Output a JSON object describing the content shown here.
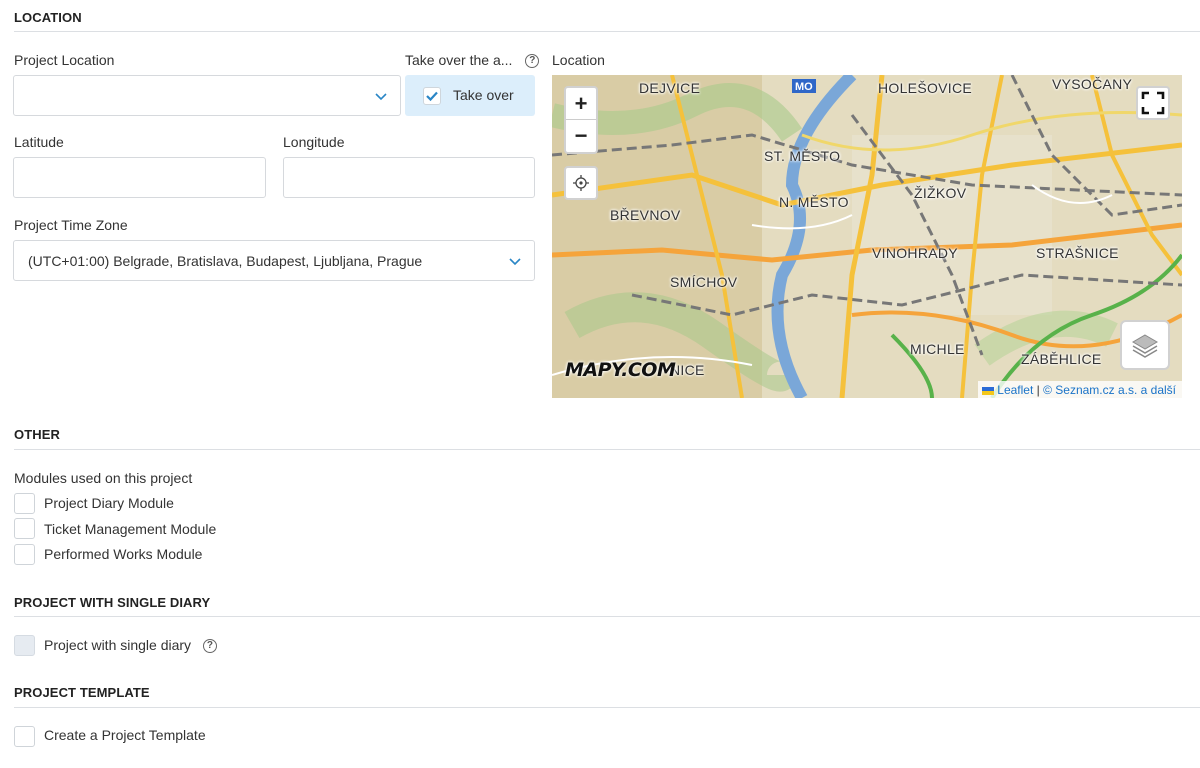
{
  "sections": {
    "location": "LOCATION",
    "other": "OTHER",
    "single_diary": "PROJECT WITH SINGLE DIARY",
    "template": "PROJECT TEMPLATE"
  },
  "location": {
    "project_location_label": "Project Location",
    "project_location_value": "",
    "take_over_label": "Take over the a...",
    "take_over_button": "Take over",
    "take_over_checked": true,
    "latitude_label": "Latitude",
    "latitude_value": "",
    "longitude_label": "Longitude",
    "longitude_value": "",
    "timezone_label": "Project Time Zone",
    "timezone_value": "(UTC+01:00) Belgrade, Bratislava, Budapest, Ljubljana, Prague",
    "map_label": "Location"
  },
  "map": {
    "zoom_in": "+",
    "zoom_out": "−",
    "places": [
      "DEJVICE",
      "HOLEŠOVICE",
      "VYSOČANY",
      "ST. MĚSTO",
      "ŽIŽKOV",
      "BŘEVNOV",
      "N. MĚSTO",
      "VINOHRADY",
      "STRAŠNICE",
      "SMÍCHOV",
      "MICHLE",
      "ZÁBĚHLICE",
      "NICE",
      "MO"
    ],
    "logo": "MAPY.COM",
    "attribution_leaflet": "Leaflet",
    "attribution_sep": " | ",
    "attribution_rest": "© Seznam.cz a.s. a další",
    "colors": {
      "roads": "#f5c13b",
      "green": "#58b24a",
      "water": "#7aa7d8",
      "land": "#d8c79a"
    }
  },
  "other": {
    "modules_label": "Modules used on this project",
    "modules": [
      {
        "label": "Project Diary Module",
        "checked": false
      },
      {
        "label": "Ticket Management Module",
        "checked": false
      },
      {
        "label": "Performed Works Module",
        "checked": false
      }
    ]
  },
  "single_diary": {
    "label": "Project with single diary",
    "checked": false,
    "disabled": true
  },
  "template": {
    "label": "Create a Project Template",
    "checked": false
  },
  "colors": {
    "accent": "#2a86c6",
    "takeover_bg": "#dceefb",
    "rule": "#dcdfe3"
  }
}
